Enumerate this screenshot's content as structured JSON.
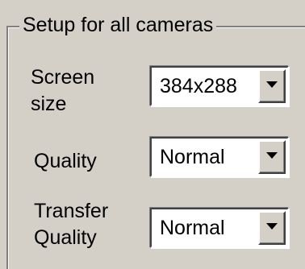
{
  "group": {
    "legend": "Setup for all cameras"
  },
  "screen_size": {
    "label_line1": "Screen",
    "label_line2": "size",
    "value": "384x288"
  },
  "quality": {
    "label": "Quality",
    "value": "Normal"
  },
  "transfer_quality": {
    "label_line1": "Transfer",
    "label_line2": "Quality",
    "value": "Normal"
  },
  "icons": {
    "dropdown_arrow": "chevron-down-icon"
  }
}
